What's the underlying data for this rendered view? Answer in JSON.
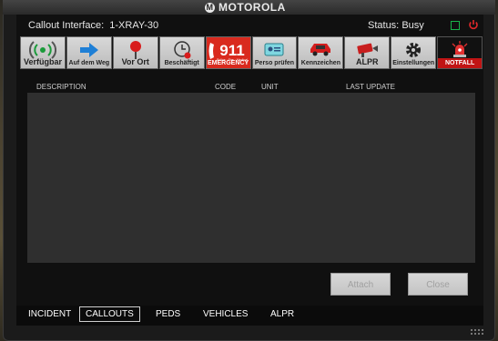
{
  "brand": {
    "name": "MOTOROLA"
  },
  "header": {
    "title": "Callout Interface:",
    "unit_id": "1-XRAY-30",
    "status_label": "Status:",
    "status_value": "Busy"
  },
  "toolbar": [
    {
      "label": "Verfügbar",
      "icon": "signal-icon"
    },
    {
      "label": "Auf dem Weg",
      "icon": "arrow-right-icon"
    },
    {
      "label": "Vor Ort",
      "icon": "location-pin-icon"
    },
    {
      "label": "Beschäftigt",
      "icon": "clock-icon"
    },
    {
      "label": "911",
      "icon": "emergency-phone-icon",
      "sublabel": "Police · Fire · Medical",
      "footer": "EMERGENCY"
    },
    {
      "label": "Perso prüfen",
      "icon": "id-card-icon"
    },
    {
      "label": "Kennzeichen",
      "icon": "car-icon"
    },
    {
      "label": "ALPR",
      "icon": "camera-icon"
    },
    {
      "label": "Einstellungen",
      "icon": "gear-icon"
    },
    {
      "label": "NOTFALL",
      "icon": "panic-icon"
    }
  ],
  "table": {
    "columns": [
      "DESCRIPTION",
      "CODE",
      "UNIT",
      "LAST UPDATE"
    ],
    "rows": []
  },
  "actions": {
    "attach": "Attach",
    "close": "Close"
  },
  "tabs": [
    "INCIDENT",
    "CALLOUTS",
    "PEDS",
    "VEHICLES",
    "ALPR"
  ],
  "active_tab": "CALLOUTS",
  "colors": {
    "emergency": "#d92a1e",
    "min_button": "#19b34a",
    "power_button": "#e0282a"
  }
}
